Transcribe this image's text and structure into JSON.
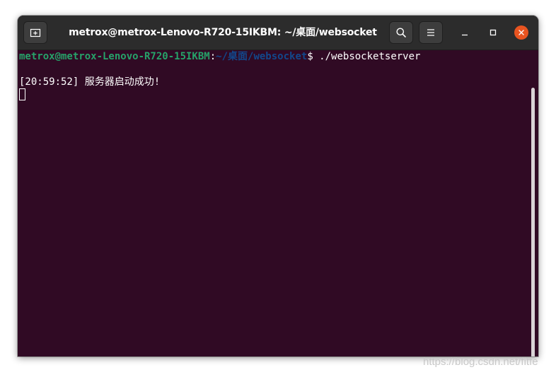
{
  "window": {
    "title": "metrox@metrox-Lenovo-R720-15IKBM: ~/桌面/websocket",
    "buttons": {
      "new_tab_icon": "new-tab-icon",
      "search_icon": "search-icon",
      "menu_icon": "hamburger-menu-icon",
      "minimize_icon": "minimize-icon",
      "maximize_icon": "maximize-icon",
      "close_icon": "close-icon"
    }
  },
  "terminal": {
    "prompt": {
      "user_host": "metrox@metrox-Lenovo-R720-15IKBM",
      "colon": ":",
      "path": "~/桌面/websocket",
      "dollar": "$",
      "command": " ./websocketserver"
    },
    "output": [
      "[20:59:52] 服务器启动成功!"
    ]
  },
  "watermark": "https://blog.csdn.net/fitfe",
  "colors": {
    "terminal_bg": "#300a24",
    "titlebar_bg": "#2c2c2c",
    "prompt_user": "#26a269",
    "prompt_path": "#12488b",
    "close_button": "#e95420"
  }
}
